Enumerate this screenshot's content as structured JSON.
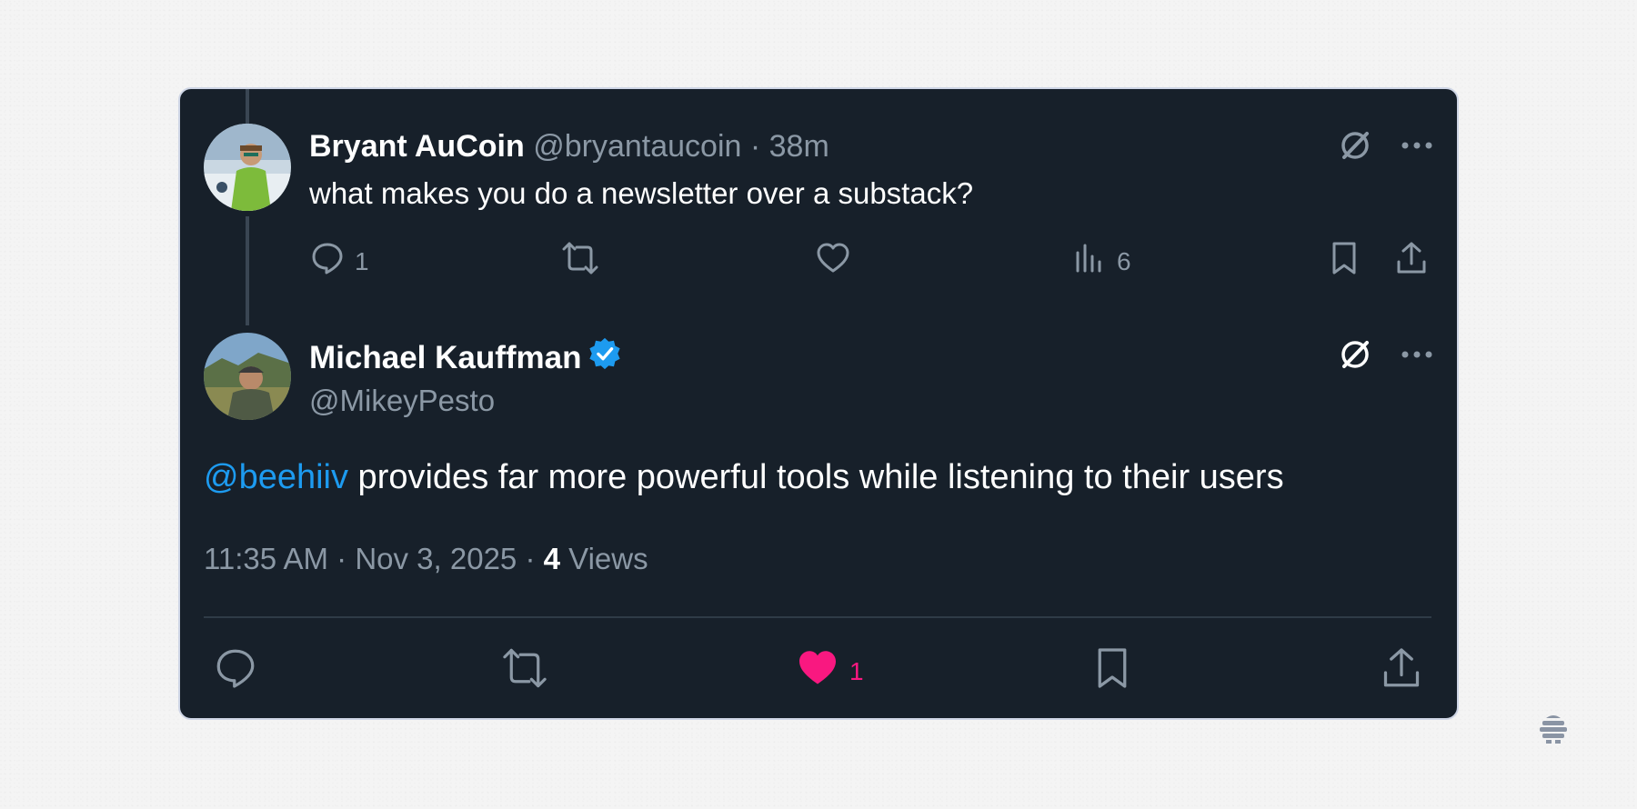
{
  "reply": {
    "author_name": "Bryant AuCoin",
    "author_handle": "@bryantaucoin",
    "separator": "·",
    "time_ago": "38m",
    "text": "what makes you do a newsletter over a substack?",
    "reply_count": "1",
    "view_count": "6"
  },
  "main": {
    "author_name": "Michael Kauffman",
    "author_handle": "@MikeyPesto",
    "mention": "@beehiiv",
    "text": " provides far more powerful tools while listening to their users",
    "time": "11:35 AM",
    "sep1": "·",
    "date": "Nov 3, 2025",
    "sep2": "·",
    "views_count": "4",
    "views_label": "Views",
    "like_count": "1"
  },
  "colors": {
    "card_bg": "#17202a",
    "text_primary": "#ffffff",
    "text_muted": "#8b98a5",
    "accent_blue": "#1d9bf0",
    "like_pink": "#f91880",
    "verified_blue": "#1d9bf0"
  },
  "icons": {
    "grok": "grok-icon",
    "more": "more-icon",
    "reply": "reply-icon",
    "repost": "repost-icon",
    "like": "heart-icon",
    "views": "views-icon",
    "bookmark": "bookmark-icon",
    "share": "share-icon",
    "verified": "verified-badge-icon",
    "watermark": "beehiiv-logo-icon"
  }
}
